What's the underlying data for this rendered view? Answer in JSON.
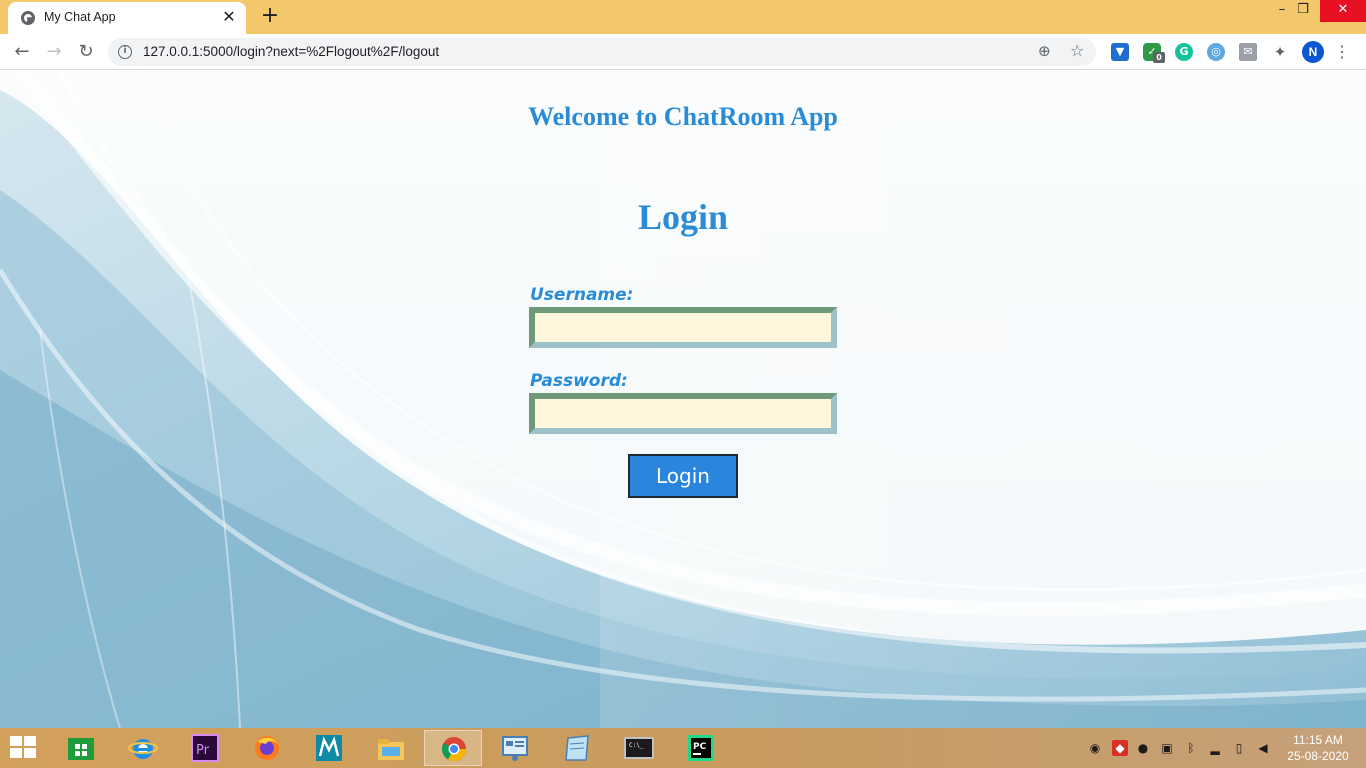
{
  "browser": {
    "tab_title": "My Chat App",
    "tab_close": "✕",
    "new_tab": "+",
    "url": "127.0.0.1:5000/login?next=%2Flogout%2F/logout",
    "profile_initial": "N",
    "extension_badge": "0",
    "window_controls": {
      "minimize": "–",
      "maximize": "❐",
      "close": "✕"
    },
    "nav": {
      "back": "←",
      "forward": "→",
      "reload": "↻"
    },
    "icons": [
      "page-info-icon",
      "zoom-icon",
      "bookmark-star-icon",
      "extensions-puzzle-icon",
      "menu-dots-icon"
    ]
  },
  "page": {
    "welcome": "Welcome to ChatRoom App",
    "title": "Login",
    "username_label": "Username:",
    "username_value": "",
    "password_label": "Password:",
    "password_value": "",
    "submit_label": "Login",
    "colors": {
      "heading": "#2a8bd6",
      "input_bg": "#fef7de",
      "button_bg": "#2a86dc"
    }
  },
  "taskbar": {
    "apps": [
      "windows-store",
      "internet-explorer",
      "adobe-premiere",
      "firefox",
      "maya",
      "file-explorer",
      "chrome",
      "control-panel",
      "notepad",
      "command-prompt",
      "pycharm"
    ],
    "clock_time": "11:15 AM",
    "clock_date": "25-08-2020"
  }
}
